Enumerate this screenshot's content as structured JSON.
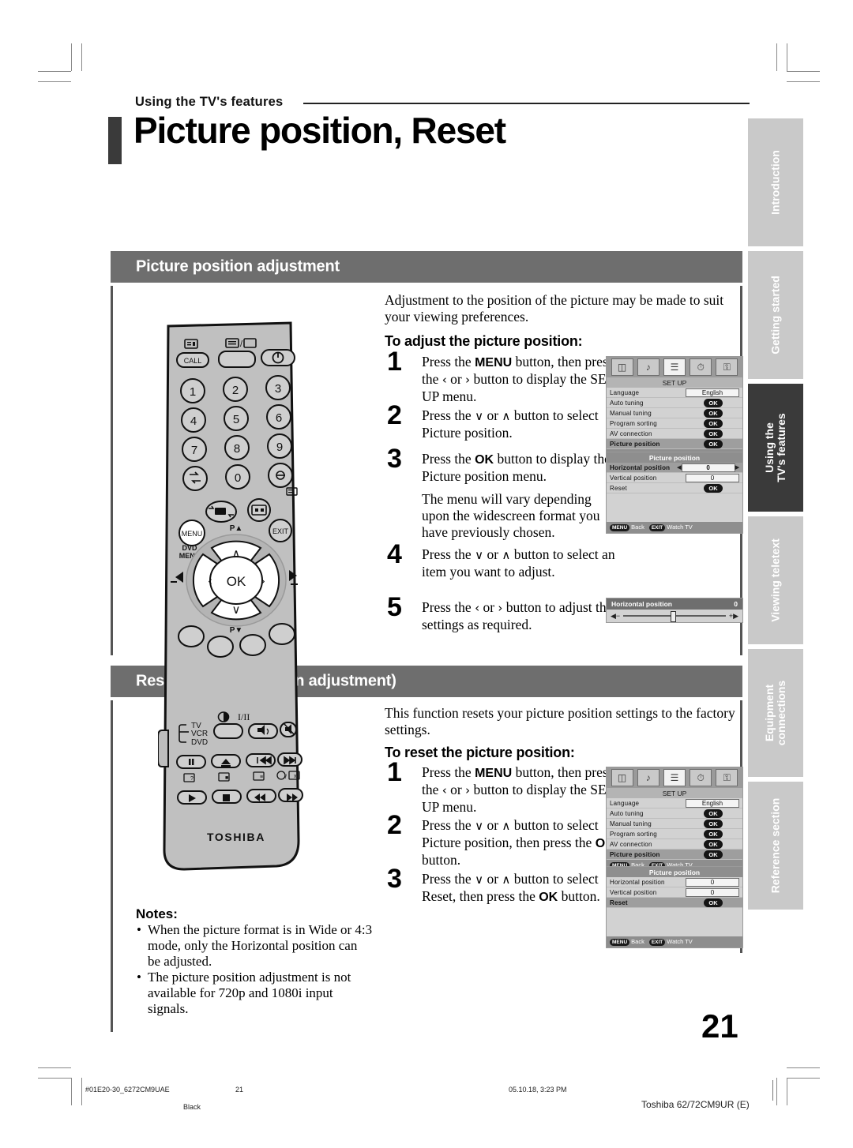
{
  "header": {
    "kicker": "Using the TV's features",
    "title": "Picture position, Reset"
  },
  "sections": {
    "adjust": {
      "heading": "Picture position adjustment",
      "intro": "Adjustment to the position of the picture may be made to suit your viewing preferences.",
      "subhead": "To adjust the picture position:",
      "steps": [
        {
          "num": "1",
          "text": "Press the MENU button, then press the ‹ or › button to display the SET UP menu."
        },
        {
          "num": "2",
          "text": "Press the ∨ or ∧ button to select Picture position."
        },
        {
          "num": "3",
          "text": "Press the OK button to display the Picture position menu."
        },
        {
          "num": "note",
          "text": "The menu will vary depending upon the widescreen format you have previously chosen."
        },
        {
          "num": "4",
          "text": "Press the ∨ or ∧ button to select an item you want to adjust."
        },
        {
          "num": "5",
          "text": "Press the ‹ or › button to adjust the settings as required."
        }
      ]
    },
    "reset": {
      "heading": "Reset (Picture position adjustment)",
      "intro": "This function resets your picture position settings to the factory settings.",
      "subhead": "To reset the picture position:",
      "steps": [
        {
          "num": "1",
          "text": "Press the MENU button, then press the ‹ or › button to display the SET UP menu."
        },
        {
          "num": "2",
          "text": "Press the ∨ or ∧ button to select Picture position, then press the OK button."
        },
        {
          "num": "3",
          "text": "Press the ∨ or ∧ button to select Reset, then press the OK button."
        }
      ]
    }
  },
  "notes": {
    "heading": "Notes:",
    "items": [
      "When the picture format is in Wide or 4:3 mode, only the Horizontal position can be adjusted.",
      "The picture position adjustment is not available for 720p and 1080i input signals."
    ]
  },
  "osd": {
    "setup": {
      "menu_title": "SET UP",
      "icons": [
        "picture-icon",
        "sound-icon",
        "setup-icon",
        "clock-icon",
        "feature-icon"
      ],
      "selected_icon_index": 2,
      "rows": [
        {
          "label": "Language",
          "value": "English",
          "type": "value"
        },
        {
          "label": "Auto tuning",
          "value": "OK",
          "type": "ok"
        },
        {
          "label": "Manual tuning",
          "value": "OK",
          "type": "ok"
        },
        {
          "label": "Program sorting",
          "value": "OK",
          "type": "ok"
        },
        {
          "label": "AV connection",
          "value": "OK",
          "type": "ok"
        },
        {
          "label": "Picture position",
          "value": "OK",
          "type": "ok",
          "highlight": true
        }
      ],
      "footer": {
        "key1": "MENU",
        "act1": "Back",
        "key2": "EXIT",
        "act2": "Watch TV"
      }
    },
    "picture_position": {
      "menu_title": "Picture position",
      "rows": [
        {
          "label": "Horizontal position",
          "value": "0",
          "type": "value",
          "highlight": true,
          "arrows": true
        },
        {
          "label": "Vertical position",
          "value": "0",
          "type": "value"
        },
        {
          "label": "Reset",
          "value": "OK",
          "type": "ok"
        }
      ],
      "footer": {
        "key1": "MENU",
        "act1": "Back",
        "key2": "EXIT",
        "act2": "Watch TV"
      }
    },
    "h_slider": {
      "label": "Horizontal position",
      "value": "0",
      "left_mark": "◀−",
      "right_mark": "+▶"
    },
    "picture_position_reset": {
      "menu_title": "Picture position",
      "rows": [
        {
          "label": "Horizontal position",
          "value": "0",
          "type": "value"
        },
        {
          "label": "Vertical position",
          "value": "0",
          "type": "value"
        },
        {
          "label": "Reset",
          "value": "OK",
          "type": "ok",
          "highlight": true
        }
      ],
      "footer": {
        "key1": "MENU",
        "act1": "Back",
        "key2": "EXIT",
        "act2": "Watch TV"
      }
    }
  },
  "side_tabs": [
    {
      "label": "Introduction",
      "active": false
    },
    {
      "label": "Getting started",
      "active": false
    },
    {
      "label": "Using the\nTV's features",
      "active": true
    },
    {
      "label": "Viewing teletext",
      "active": false
    },
    {
      "label": "Equipment\nconnections",
      "active": false
    },
    {
      "label": "Reference section",
      "active": false
    }
  ],
  "remote": {
    "brand": "TOSHIBA",
    "buttons": {
      "call": "CALL",
      "menu": "MENU",
      "dvd_menu": "DVD\nMENU",
      "exit": "EXIT",
      "ok": "OK",
      "p_up": "P▲",
      "p_down": "P▼",
      "numbers": [
        "1",
        "2",
        "3",
        "4",
        "5",
        "6",
        "7",
        "8",
        "9",
        "0"
      ],
      "mode_tv": "TV",
      "mode_vcr": "VCR",
      "mode_dvd": "DVD",
      "sound_ii": "I/II"
    }
  },
  "page_number": "21",
  "footer": {
    "doc_code": "#01E20-30_6272CM9UAE",
    "page": "21",
    "color": "Black",
    "timestamp": "05.10.18, 3:23 PM",
    "model": "Toshiba 62/72CM9UR (E)"
  }
}
